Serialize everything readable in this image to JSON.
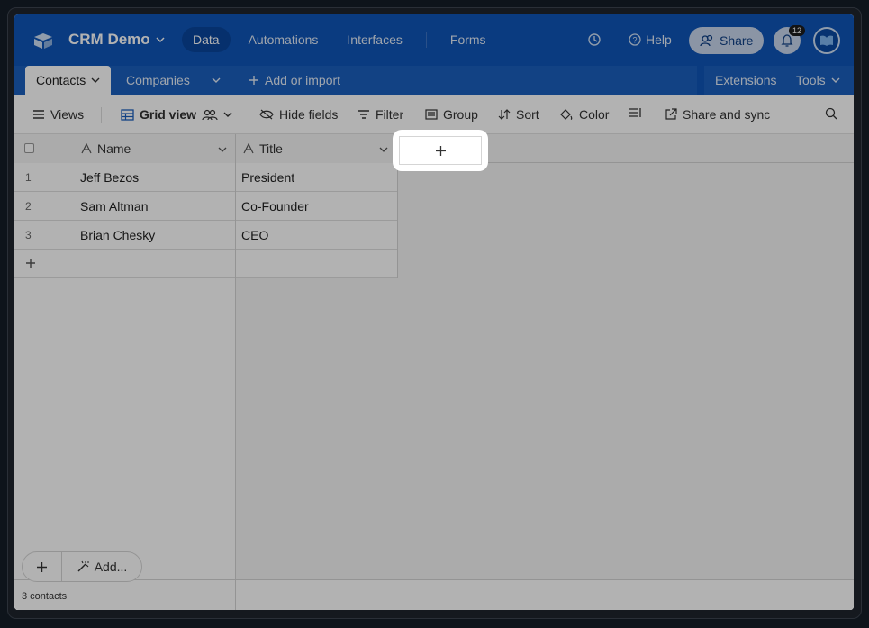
{
  "app": {
    "base_name": "CRM Demo",
    "nav": [
      "Data",
      "Automations",
      "Interfaces",
      "Forms"
    ],
    "help_label": "Help",
    "share_label": "Share",
    "notification_count": "12"
  },
  "tabs": {
    "items": [
      "Contacts",
      "Companies"
    ],
    "add_import_label": "Add or import",
    "extensions_label": "Extensions",
    "tools_label": "Tools"
  },
  "toolbar": {
    "views_label": "Views",
    "grid_view_label": "Grid view",
    "hide_fields_label": "Hide fields",
    "filter_label": "Filter",
    "group_label": "Group",
    "sort_label": "Sort",
    "color_label": "Color",
    "share_sync_label": "Share and sync"
  },
  "grid": {
    "columns": [
      "Name",
      "Title"
    ],
    "rows": [
      {
        "num": "1",
        "name": "Jeff Bezos",
        "title": "President"
      },
      {
        "num": "2",
        "name": "Sam Altman",
        "title": "Co-Founder"
      },
      {
        "num": "3",
        "name": "Brian Chesky",
        "title": "CEO"
      }
    ],
    "record_count": "3 contacts",
    "add_label": "Add..."
  },
  "colors": {
    "brand_blue": "#0f55b8",
    "overlay": "rgba(0,0,0,0.30)"
  }
}
